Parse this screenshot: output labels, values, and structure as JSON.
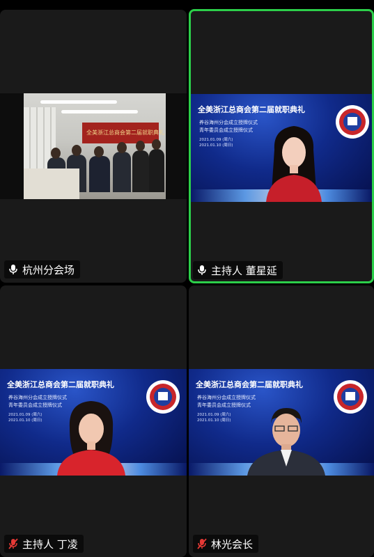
{
  "tiles": [
    {
      "name": "杭州分会场",
      "speaking": false,
      "muted": false
    },
    {
      "name": "主持人 董星延",
      "speaking": true,
      "muted": false
    },
    {
      "name": "主持人 丁凌",
      "speaking": false,
      "muted": true
    },
    {
      "name": "林光会长",
      "speaking": false,
      "muted": true
    }
  ],
  "room": {
    "banner": "全美浙江总商会第二届就职典礼"
  },
  "stage": {
    "title": "全美浙江总商会第二届就职典礼",
    "line1": "养谷海州分会成立授牌仪式",
    "line2": "青年委员会成立授牌仪式",
    "date1": "2021.01.09 (周六)",
    "date2": "2021.01.10 (周日)"
  },
  "colors": {
    "active_border": "#2ccf4a",
    "muted_mic": "#e53935"
  }
}
